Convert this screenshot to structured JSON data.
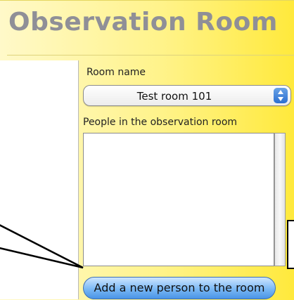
{
  "title": "Observation Room",
  "room_name": {
    "label": "Room name",
    "selected": "Test room 101"
  },
  "people": {
    "label": "People in the observation room",
    "items": []
  },
  "add_button": "Add a new person to the room"
}
